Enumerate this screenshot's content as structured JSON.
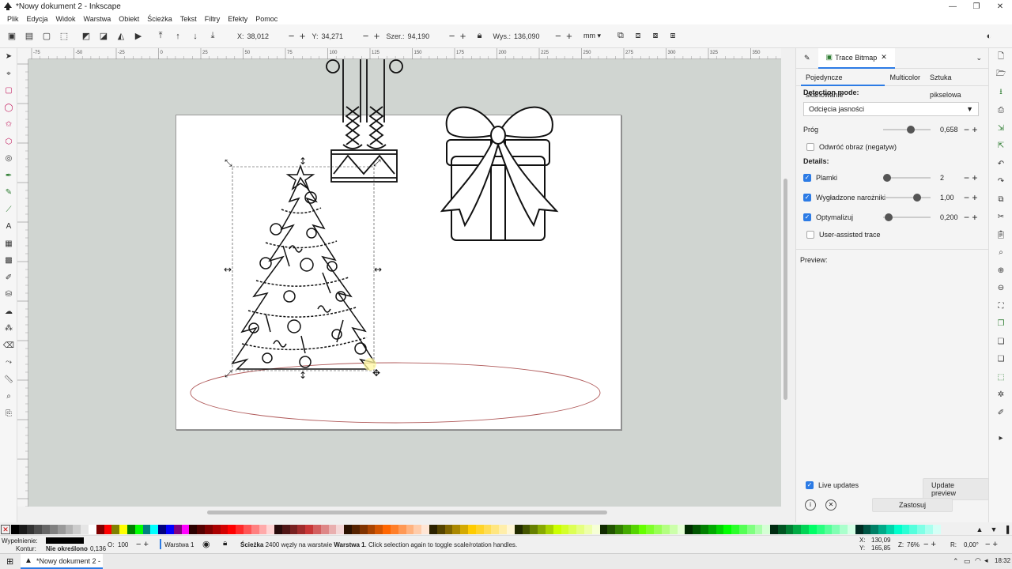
{
  "window": {
    "title": "*Nowy dokument 2 - Inkscape",
    "min": "—",
    "max": "❐",
    "close": "✕"
  },
  "menu": [
    "Plik",
    "Edycja",
    "Widok",
    "Warstwa",
    "Obiekt",
    "Ścieżka",
    "Tekst",
    "Filtry",
    "Efekty",
    "Pomoc"
  ],
  "toolbar": {
    "x_label": "X:",
    "x_value": "38,012",
    "y_label": "Y:",
    "y_value": "34,271",
    "w_label": "Szer.:",
    "w_value": "94,190",
    "h_label": "Wys.:",
    "h_value": "136,090",
    "unit": "mm"
  },
  "ruler_ticks": [
    "-75",
    "-50",
    "-25",
    "0",
    "25",
    "50",
    "75",
    "100",
    "125",
    "150",
    "175",
    "200",
    "225",
    "250",
    "275",
    "300",
    "325",
    "350",
    "375"
  ],
  "dock": {
    "tab_trace": "Trace Bitmap",
    "subtabs": [
      "Pojedyncze skanowanie",
      "Multicolor",
      "Sztuka pikselowa"
    ],
    "detection_mode_label": "Detection mode:",
    "detection_mode_value": "Odcięcia jasności",
    "prog_label": "Próg",
    "prog_value": "0,658",
    "invert_label": "Odwróć obraz (negatyw)",
    "details_label": "Details:",
    "plamki_label": "Plamki",
    "plamki_value": "2",
    "narozniki_label": "Wygładzone narożniki",
    "narozniki_value": "1,00",
    "optymalizuj_label": "Optymalizuj",
    "optymalizuj_value": "0,200",
    "user_assisted_label": "User-assisted trace",
    "preview_label": "Preview:",
    "live_updates_label": "Live updates",
    "update_preview_label": "Update preview",
    "apply_label": "Zastosuj"
  },
  "status": {
    "fill_label": "Wypełnienie:",
    "stroke_label": "Kontur:",
    "stroke_value": "Nie określono",
    "stroke_width": "0,136",
    "opacity_label": "O:",
    "opacity_value": "100",
    "layer": "Warstwa 1",
    "message_bold": "Ścieżka",
    "message_mid": " 2400 węzły na warstwie ",
    "message_layer": "Warstwa 1",
    "message_end": ". Click selection again to toggle scale/rotation handles.",
    "cursor_x": "130,09",
    "cursor_y": "165,85",
    "zoom_label": "Z:",
    "zoom_value": "76%",
    "rotation_label": "R:",
    "rotation_value": "0,00°"
  },
  "taskbar": {
    "app_label": "*Nowy dokument 2 - ...",
    "time": "18:32"
  },
  "palette_colors": [
    "#000000",
    "#1a1a1a",
    "#333333",
    "#4d4d4d",
    "#666666",
    "#808080",
    "#999999",
    "#b3b3b3",
    "#cccccc",
    "#e6e6e6",
    "#ffffff",
    "#800000",
    "#ff0000",
    "#808000",
    "#ffff00",
    "#008000",
    "#00ff00",
    "#008080",
    "#00ffff",
    "#000080",
    "#0000ff",
    "#800080",
    "#ff00ff",
    "#2b0000",
    "#550000",
    "#800000",
    "#aa0000",
    "#d40000",
    "#ff0000",
    "#ff2a2a",
    "#ff5555",
    "#ff8080",
    "#ffaaaa",
    "#ffd5d5",
    "#280b0b",
    "#501616",
    "#782121",
    "#a02c2c",
    "#c83737",
    "#d35f5f",
    "#de8787",
    "#e9afaf",
    "#f4d7d7",
    "#2b1100",
    "#552200",
    "#803300",
    "#aa4400",
    "#d45500",
    "#ff6600",
    "#ff7f2a",
    "#ff9955",
    "#ffb380",
    "#ffccaa",
    "#ffe6d5",
    "#2b2200",
    "#554400",
    "#806600",
    "#aa8800",
    "#d4aa00",
    "#ffcc00",
    "#ffd42a",
    "#ffdd55",
    "#ffe680",
    "#ffeeaa",
    "#fff6d5",
    "#222b00",
    "#445500",
    "#668000",
    "#88aa00",
    "#aad400",
    "#ccff00",
    "#d4ff2a",
    "#ddff55",
    "#e5ff80",
    "#eeffaa",
    "#f6ffd5",
    "#112b00",
    "#225500",
    "#338000",
    "#44aa00",
    "#55d400",
    "#66ff00",
    "#7fff2a",
    "#99ff55",
    "#b3ff80",
    "#ccffaa",
    "#e5ffd5",
    "#002b00",
    "#005500",
    "#008000",
    "#00aa00",
    "#00d400",
    "#00ff00",
    "#2aff2a",
    "#55ff55",
    "#80ff80",
    "#aaffaa",
    "#d5ffd5",
    "#002b11",
    "#005522",
    "#008033",
    "#00aa44",
    "#00d455",
    "#00ff66",
    "#2aff80",
    "#55ff99",
    "#80ffb3",
    "#aaffcc",
    "#d5ffe6",
    "#002b22",
    "#005544",
    "#008066",
    "#00aa88",
    "#00d4aa",
    "#00ffcc",
    "#2affd5",
    "#55ffdd",
    "#80ffe6",
    "#aaffee",
    "#d5fff6"
  ]
}
